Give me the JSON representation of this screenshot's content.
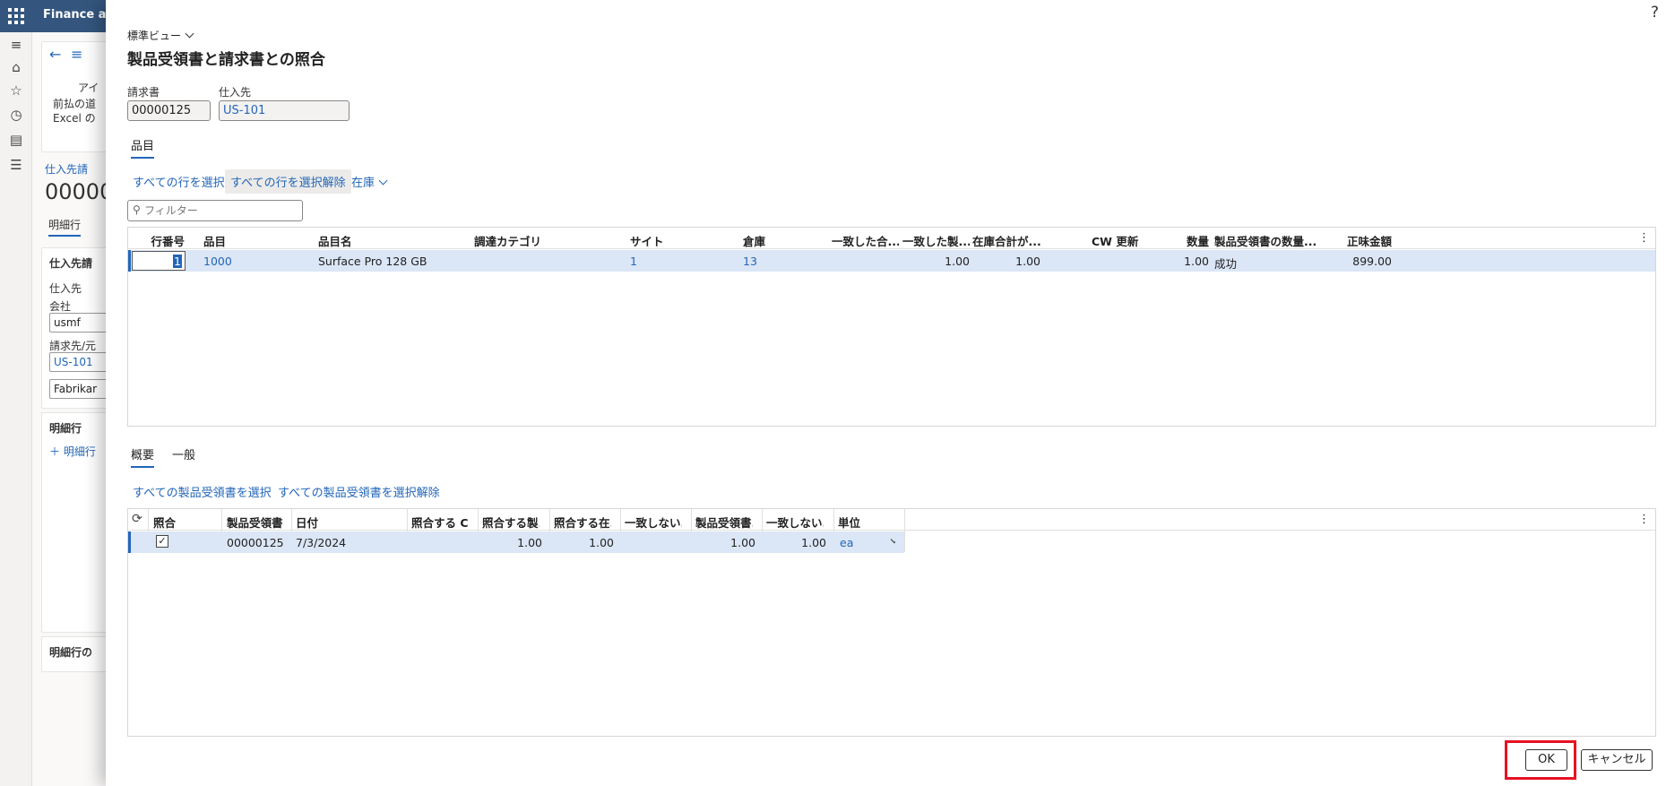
{
  "app": {
    "title": "Finance and"
  },
  "background": {
    "header_line": "アイ",
    "card_line1": "前払の道",
    "card_line2": "Excel の",
    "breadcrumb": "仕入先請",
    "record_title": "00000",
    "tab": "明細行",
    "section_title": "仕入先請",
    "vendor_label": "仕入先",
    "company_label": "会社",
    "company_value": "usmf",
    "billto_label": "請求先/元",
    "billto_value": "US-101",
    "name_value": "Fabrikar",
    "lines_title": "明細行",
    "add_line": "明細行",
    "footer_title": "明細行の"
  },
  "dialog": {
    "view_selector": "標準ビュー",
    "title": "製品受領書と請求書との照合",
    "help": "?",
    "invoice_label": "請求書",
    "invoice_value": "00000125",
    "vendor_label": "仕入先",
    "vendor_value": "US-101",
    "items_tab": "品目",
    "actions": {
      "select_all": "すべての行を選択",
      "deselect_all": "すべての行を選択解除",
      "inventory": "在庫"
    },
    "filter_placeholder": "フィルター",
    "lines_grid": {
      "headers": [
        "行番号",
        "品目",
        "品目名",
        "調達カテゴリ",
        "サイト",
        "倉庫",
        "一致した合...",
        "一致した製...",
        "在庫合計が...",
        "CW 更新",
        "数量",
        "製品受領書の数量...",
        "正味金額"
      ],
      "row": {
        "line": "1",
        "item": "1000",
        "item_name": "Surface Pro 128 GB",
        "category": "",
        "site": "1",
        "warehouse": "13",
        "matched_total": "",
        "matched_product": "1.00",
        "inventory_total": "1.00",
        "cw_update": "",
        "quantity": "1.00",
        "receipt_qty_status": "成功",
        "net_amount": "899.00"
      }
    },
    "bottom_tabs": {
      "overview": "概要",
      "general": "一般"
    },
    "receipt_actions": {
      "select_all": "すべての製品受領書を選択",
      "deselect_all": "すべての製品受領書を選択解除"
    },
    "receipt_grid": {
      "headers": [
        "照合",
        "製品受領書",
        "日付",
        "照合する C...",
        "照合する製...",
        "照合する在...",
        "一致しない...",
        "製品受領書...",
        "一致しない...",
        "単位"
      ],
      "row": {
        "match": true,
        "receipt": "00000125",
        "date": "7/3/2024",
        "match_c": "",
        "match_product": "1.00",
        "match_inventory": "1.00",
        "unmatched1": "",
        "receipt_qty": "1.00",
        "unmatched2": "1.00",
        "unit": "ea"
      }
    },
    "buttons": {
      "ok": "OK",
      "cancel": "キャンセル"
    }
  },
  "colors": {
    "accent": "#2266b8",
    "topbar": "#34567e",
    "highlight": "#e81123",
    "selected_row": "#dbe6f6"
  }
}
